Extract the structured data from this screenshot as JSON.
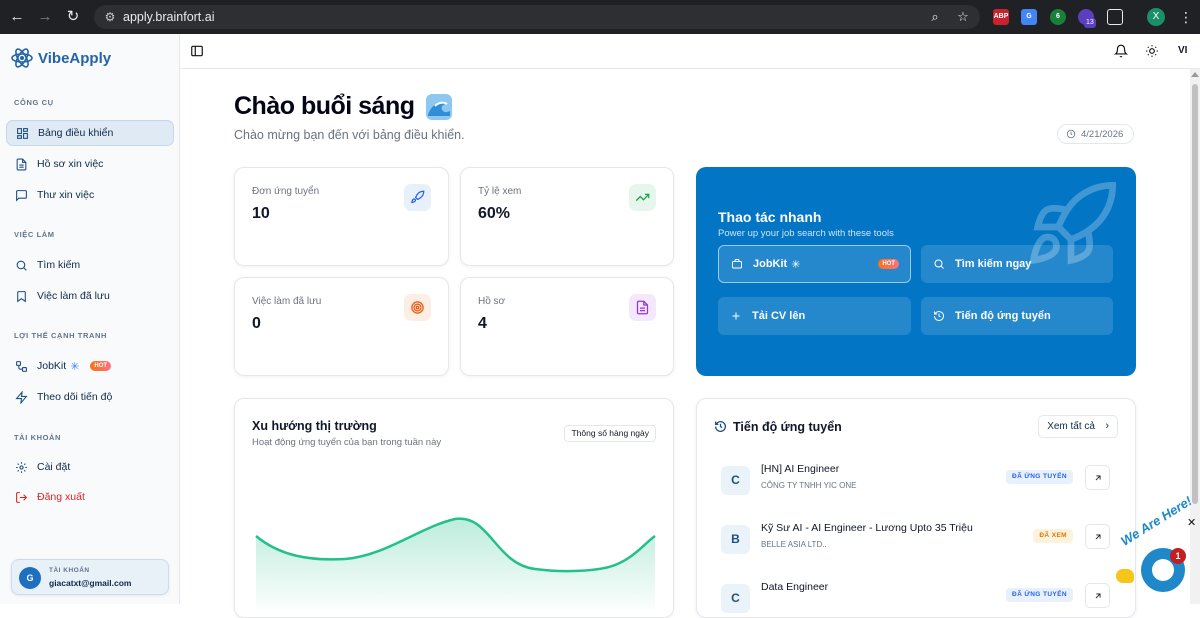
{
  "browser": {
    "url": "apply.brainfort.ai",
    "extensions": [
      {
        "name": "abp-icon",
        "label": "ABP",
        "color": "#c7232e"
      },
      {
        "name": "translate-icon",
        "label": "G",
        "color": "#4285f4"
      },
      {
        "name": "sheets-ext-icon",
        "label": "6",
        "color": "#188038"
      },
      {
        "name": "notify-ext-icon",
        "label": "",
        "color": "#5b3fbf"
      },
      {
        "name": "puzzle-icon",
        "label": "",
        "color": "#1f2124"
      }
    ],
    "ext_badge": "13",
    "profile_initial": "X"
  },
  "sidebar": {
    "brand": "VibeApply",
    "sections": {
      "tools": "Công cụ",
      "jobs": "Việc làm",
      "advantage": "Lợi thế cạnh tranh",
      "account": "Tài khoản"
    },
    "items": {
      "dashboard": "Bảng điều khiển",
      "profile": "Hồ sơ xin việc",
      "cover_letter": "Thư xin việc",
      "search": "Tìm kiếm",
      "saved": "Việc làm đã lưu",
      "jobkit": "JobKit",
      "jobkit_badge": "HOT",
      "track": "Theo dõi tiến độ",
      "settings": "Cài đặt",
      "logout": "Đăng xuất"
    },
    "account_card": {
      "label": "TÀI KHOẢN",
      "initial": "G",
      "email": "giacatxt@gmail.com"
    }
  },
  "topbar": {
    "lang": "VI"
  },
  "main": {
    "greeting": "Chào buổi sáng",
    "subtitle": "Chào mừng bạn đến với bảng điều khiển.",
    "date": "4/21/2026",
    "stats": [
      {
        "label": "Đơn ứng tuyển",
        "value": "10",
        "icon": "rocket-icon",
        "color": "#2563eb",
        "bg": "#e8f0fb"
      },
      {
        "label": "Tỷ lệ xem",
        "value": "60%",
        "icon": "trending-up-icon",
        "color": "#16a34a",
        "bg": "#e6f6ec"
      },
      {
        "label": "Việc làm đã lưu",
        "value": "0",
        "icon": "target-icon",
        "color": "#ea580c",
        "bg": "#fdeee3"
      },
      {
        "label": "Hồ sơ",
        "value": "4",
        "icon": "file-icon",
        "color": "#9333ea",
        "bg": "#f3e8fd"
      }
    ],
    "quick": {
      "title": "Thao tác nhanh",
      "subtitle": "Power up your job search with these tools",
      "buttons": {
        "jobkit": "JobKit",
        "jobkit_badge": "HOT",
        "search": "Tìm kiếm ngay",
        "upload": "Tải CV lên",
        "progress": "Tiến độ ứng tuyển"
      }
    },
    "market": {
      "title": "Xu hướng thị trường",
      "subtitle": "Hoạt động ứng tuyển của bạn trong tuần này",
      "pill": "Thông số hàng ngày",
      "line_color": "#22c08a"
    },
    "progress": {
      "title": "Tiến độ ứng tuyển",
      "see_all": "Xem tất cả",
      "rows": [
        {
          "initial": "C",
          "job": "[HN] AI Engineer",
          "company": "CÔNG TY TNHH YIC ONE",
          "status": "ĐÃ ỨNG TUYỂN",
          "status_color": "#2563eb",
          "status_bg": "#e8f0fb"
        },
        {
          "initial": "B",
          "job": "Kỹ Sư AI - AI Engineer - Lương Upto 35 Triệu",
          "company": "BELLE ASIA LTD..",
          "status": "ĐÃ XEM",
          "status_color": "#d97706",
          "status_bg": "#fdf3dc"
        },
        {
          "initial": "C",
          "job": "Data Engineer",
          "company": "",
          "status": "ĐÃ ỨNG TUYỂN",
          "status_color": "#2563eb",
          "status_bg": "#e8f0fb"
        }
      ]
    }
  },
  "chat": {
    "text": "We Are Here!",
    "badge": "1"
  }
}
